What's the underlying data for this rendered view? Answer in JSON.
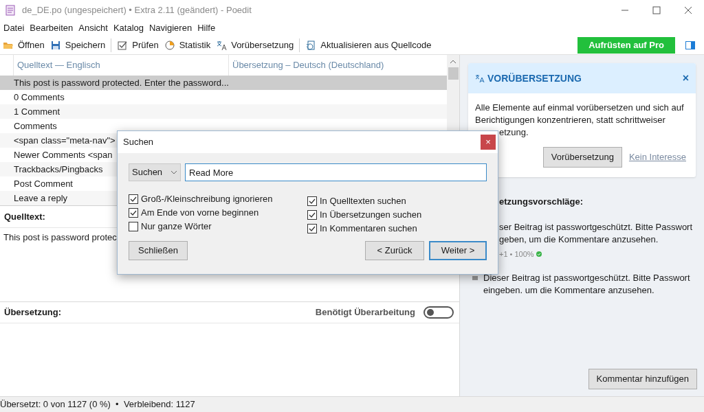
{
  "window": {
    "title": "de_DE.po (ungespeichert) • Extra 2.11 (geändert) - Poedit"
  },
  "menu": [
    "Datei",
    "Bearbeiten",
    "Ansicht",
    "Katalog",
    "Navigieren",
    "Hilfe"
  ],
  "toolbar": [
    {
      "kind": "open",
      "label": "Öffnen"
    },
    {
      "kind": "save",
      "label": "Speichern"
    },
    {
      "kind": "separator"
    },
    {
      "kind": "check",
      "label": "Prüfen"
    },
    {
      "kind": "stats",
      "label": "Statistik"
    },
    {
      "kind": "translate",
      "label": "Vorübersetzung"
    },
    {
      "kind": "separator"
    },
    {
      "kind": "update",
      "label": "Aktualisieren aus Quellcode"
    }
  ],
  "upgrade_button": "Aufrüsten auf Pro",
  "table": {
    "columns": [
      "Quelltext — Englisch",
      "Übersetzung – Deutsch (Deutschland)"
    ],
    "rows": [
      {
        "source": "This post is password protected. Enter the password...",
        "selected": true
      },
      {
        "source": "0 Comments",
        "selected": false
      },
      {
        "source": "1 Comment",
        "selected": false
      },
      {
        "source": "Comments",
        "selected": false
      },
      {
        "source": "<span class=\"meta-nav\">",
        "selected": false
      },
      {
        "source": "Newer Comments <span",
        "selected": false
      },
      {
        "source": "Trackbacks/Pingbacks",
        "selected": false
      },
      {
        "source": "Post Comment",
        "selected": false
      },
      {
        "source": "Leave a reply",
        "selected": false
      }
    ]
  },
  "source_pane": {
    "label": "Quelltext:",
    "text": "This post is password protec"
  },
  "translation_pane": {
    "label": "Übersetzung:",
    "needs_review_label": "Benötigt Überarbeitung",
    "needs_review": false
  },
  "pretranslate_card": {
    "title": "VORÜBERSETZUNG",
    "close": "×",
    "text": "Alle Elemente auf einmal vorübersetzen und sich auf Berichtigungen konzentrieren, statt schrittweiser",
    "text_tail": "etzung.",
    "button": "Vorübersetzung",
    "link": "Kein Interesse"
  },
  "suggestions": {
    "heading": "etzungsvorschläge:",
    "items": [
      {
        "lines": [
          "ser Beitrag ist passwortgeschützt. Bitte Passwort",
          "geben, um die Kommentare anzusehen."
        ],
        "meta": "+1 • 100%",
        "kind": "covered"
      },
      {
        "lines": [
          "Dieser Beitrag ist passwortgeschützt. Bitte Passwort",
          "eingeben. um die Kommentare anzusehen."
        ],
        "kind": "plain"
      }
    ]
  },
  "comment_button": "Kommentar hinzufügen",
  "status_bar": "Übersetzt: 0 von 1127 (0 %)  •  Verbleibend: 1127",
  "find_dialog": {
    "title": "Suchen",
    "close": "×",
    "mode": "Suchen",
    "query": "Read More",
    "option_groups": [
      [
        {
          "label": "Groß-/Kleinschreibung ignorieren",
          "checked": true
        },
        {
          "label": "Am Ende von vorne beginnen",
          "checked": true
        },
        {
          "label": "Nur ganze Wörter",
          "checked": false
        }
      ],
      [
        {
          "label": "In Quelltexten suchen",
          "checked": true
        },
        {
          "label": "In Übersetzungen suchen",
          "checked": true
        },
        {
          "label": "In Kommentaren suchen",
          "checked": true
        }
      ]
    ],
    "close_button": "Schließen",
    "back_button": "< Zurück",
    "next_button": "Weiter >"
  }
}
